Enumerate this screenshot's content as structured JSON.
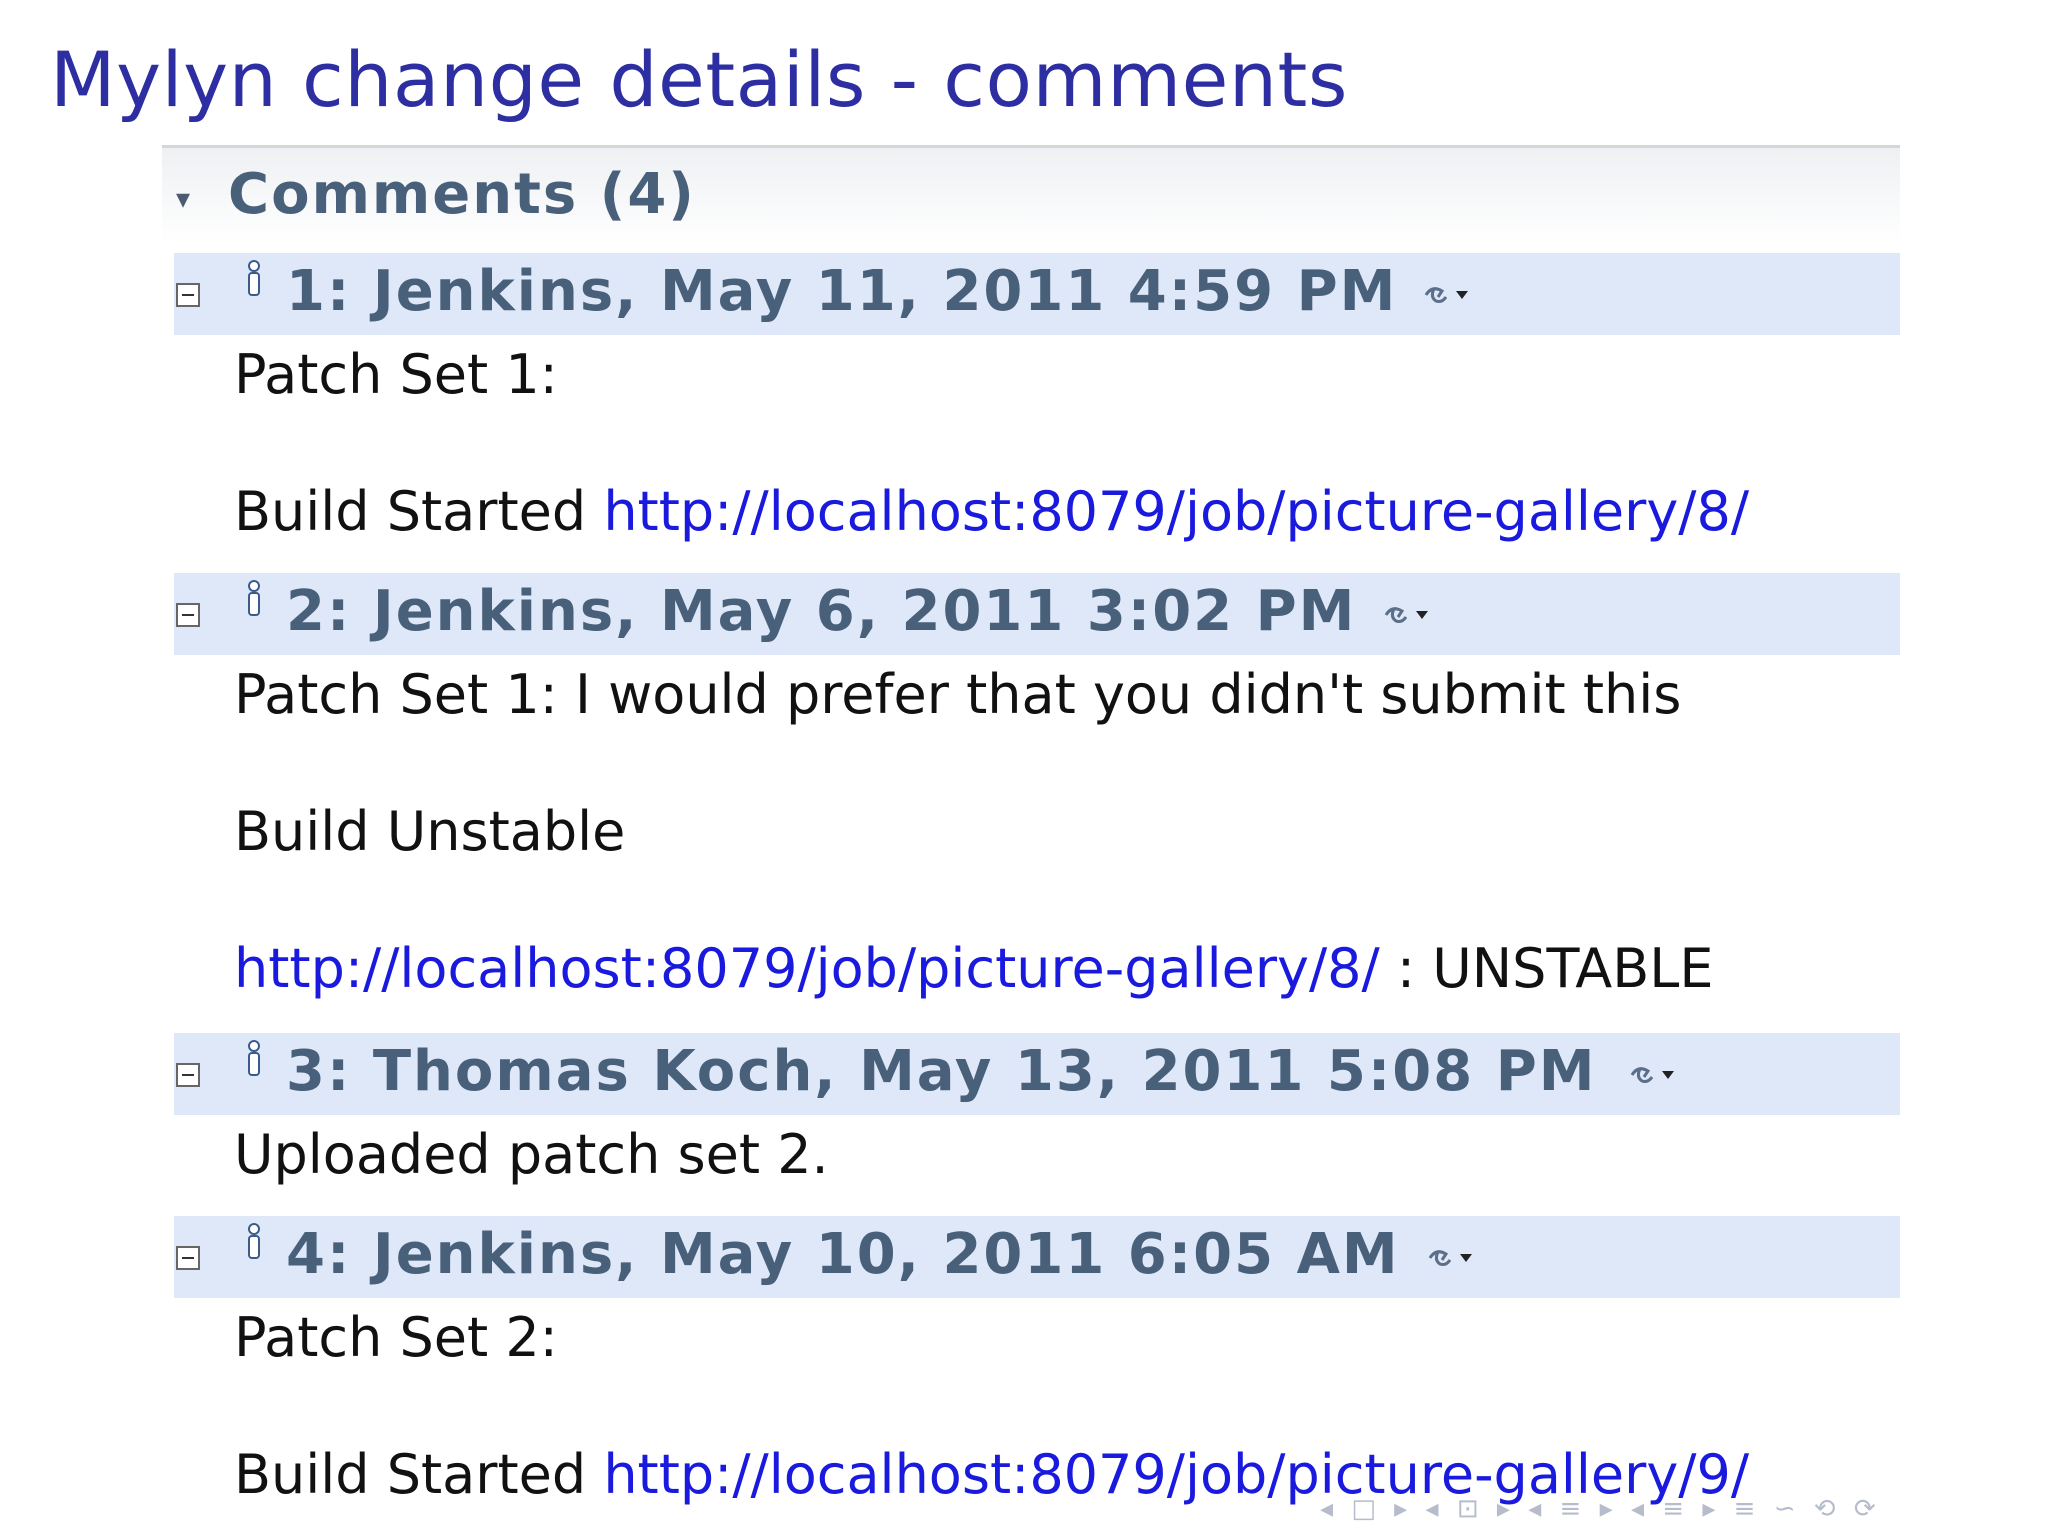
{
  "slide": {
    "title": "Mylyn change details - comments"
  },
  "section": {
    "toggle": "▾",
    "title": "Comments (4)"
  },
  "comments": [
    {
      "header": "1: Jenkins, May 11, 2011 4:59 PM",
      "line1": "Patch Set 1:",
      "line2_prefix": "Build Started ",
      "line2_link": "http://localhost:8079/job/picture-gallery/8/"
    },
    {
      "header": "2: Jenkins, May 6, 2011 3:02 PM",
      "line1": "Patch Set 1: I would prefer that you didn't submit this",
      "line2": "Build Unstable",
      "line3_link": "http://localhost:8079/job/picture-gallery/8/",
      "line3_suffix": " : UNSTABLE"
    },
    {
      "header": "3: Thomas Koch, May 13, 2011 5:08 PM",
      "line1": "Uploaded patch set 2."
    },
    {
      "header": "4: Jenkins, May 10, 2011 6:05 AM",
      "line1": "Patch Set 2:",
      "line2_prefix": "Build Started ",
      "line2_link": "http://localhost:8079/job/picture-gallery/9/"
    }
  ],
  "nav": {
    "items": [
      "◂",
      "□",
      "▸",
      "◂",
      "⊡",
      "▸",
      "◂",
      "≡",
      "▸",
      "◂",
      "≡",
      "▸",
      "≡",
      "∽",
      "⟲",
      "⟳"
    ]
  }
}
